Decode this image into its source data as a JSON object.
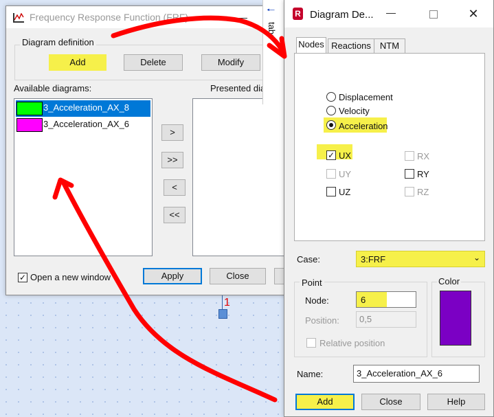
{
  "frf": {
    "title": "Frequency Response Function (FRF)",
    "group_label": "Diagram definition",
    "add": "Add",
    "delete": "Delete",
    "modify": "Modify",
    "available_label": "Available diagrams:",
    "presented_label": "Presented diagrams",
    "items": [
      {
        "label": "3_Acceleration_AX_8",
        "color": "#00ff00"
      },
      {
        "label": "3_Acceleration_AX_6",
        "color": "#ff00ff"
      }
    ],
    "move_right": ">",
    "move_all_right": ">>",
    "move_left": "<",
    "move_all_left": "<<",
    "open_new_window": "Open a new window",
    "apply": "Apply",
    "close": "Close"
  },
  "side_tab": {
    "label": "tabs"
  },
  "marker": {
    "label": "1"
  },
  "dd": {
    "title": "Diagram De...",
    "tabs": [
      "Nodes",
      "Reactions",
      "NTM"
    ],
    "radios": [
      "Displacement",
      "Velocity",
      "Acceleration"
    ],
    "checks": {
      "ux": "UX",
      "uy": "UY",
      "uz": "UZ",
      "rx": "RX",
      "ry": "RY",
      "rz": "RZ"
    },
    "case_label": "Case:",
    "case_value": "3:FRF",
    "point_label": "Point",
    "node_label": "Node:",
    "node_value": "6",
    "position_label": "Position:",
    "position_value": "0,5",
    "relative_label": "Relative position",
    "color_label": "Color",
    "color": "#7b00c4",
    "name_label": "Name:",
    "name_value": "3_Acceleration_AX_6",
    "add": "Add",
    "close": "Close",
    "help": "Help"
  },
  "colors": {
    "highlight": "#f6f04a",
    "annotation": "#ff0000",
    "selection": "#0078d7"
  }
}
